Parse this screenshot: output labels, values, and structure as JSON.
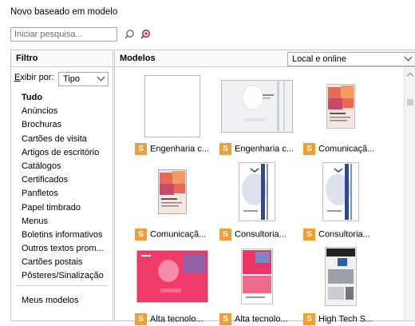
{
  "window": {
    "title": "Novo baseado em modelo"
  },
  "search": {
    "placeholder": "Iniciar pesquisa..."
  },
  "filter": {
    "header": "Filtro",
    "show_by_label": "Exibir por:",
    "show_by_accel": "E",
    "show_by_rest": "xibir por:",
    "show_by_value": "Tipo",
    "categories": [
      "Tudo",
      "Anúncios",
      "Brochuras",
      "Cartões de visita",
      "Artigos de escritório",
      "Catálogos",
      "Certificados",
      "Panfletos",
      "Papel timbrado",
      "Menus",
      "Boletins informativos",
      "Outros textos prom...",
      "Cartões postais",
      "Pôsteres/Sinalização"
    ],
    "my_templates": "Meus modelos"
  },
  "models": {
    "header": "Modelos",
    "location_value": "Local e online",
    "badge_letter": "S",
    "items": [
      {
        "label": "Engenharia c...",
        "thumb": "blank"
      },
      {
        "label": "Engenharia c...",
        "thumb": "grey-landscape"
      },
      {
        "label": "Comunicaçã...",
        "thumb": "red-portrait"
      },
      {
        "label": "Comunicaçã...",
        "thumb": "red-portrait-dashed"
      },
      {
        "label": "Consultoria...",
        "thumb": "blue-balloon"
      },
      {
        "label": "Consultoria...",
        "thumb": "blue-balloon-2"
      },
      {
        "label": "Alta tecnolo...",
        "thumb": "pink-landscape"
      },
      {
        "label": "Alta tecnolo...",
        "thumb": "pink-portrait"
      },
      {
        "label": "High Tech S...",
        "thumb": "bw-portrait"
      }
    ]
  },
  "colors": {
    "badge": "#f0a030",
    "border": "#c8c8c8",
    "selection": "#e06070"
  }
}
